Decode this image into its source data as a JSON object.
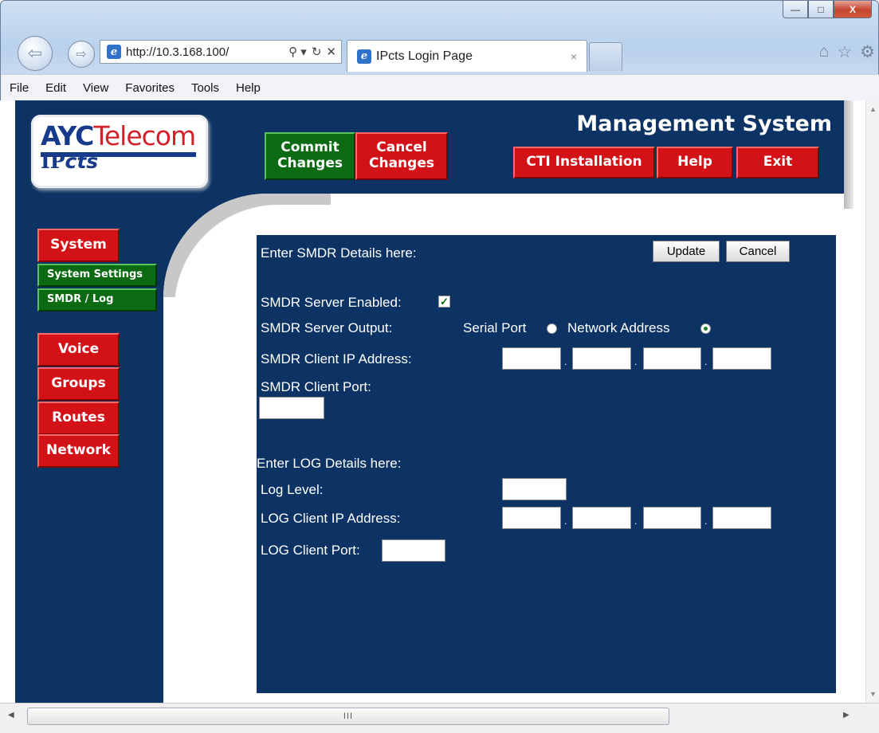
{
  "browser": {
    "window_controls": {
      "minimize": "—",
      "maximize": "□",
      "close": "X"
    },
    "address": "http://10.3.168.100/",
    "address_tools": [
      "⚲ ▾",
      "↻",
      "✕"
    ],
    "tab_title": "IPcts Login Page",
    "tab_close": "×",
    "toolbar_icons": [
      "⌂",
      "☆",
      "⚙"
    ],
    "menu": [
      "File",
      "Edit",
      "View",
      "Favorites",
      "Tools",
      "Help"
    ],
    "hscroll_grip": "III"
  },
  "header": {
    "logo_part1": "AYC",
    "logo_part2": "Telecom",
    "logo_sub1": "IP",
    "logo_sub2": "cts",
    "title": "Management System",
    "commit_line1": "Commit",
    "commit_line2": "Changes",
    "cancel_line1": "Cancel",
    "cancel_line2": "Changes",
    "cti": "CTI Installation",
    "help": "Help",
    "exit": "Exit"
  },
  "sidebar": {
    "system": "System",
    "system_settings": "System Settings",
    "smdr_log": "SMDR / Log",
    "voice": "Voice",
    "groups": "Groups",
    "routes": "Routes",
    "network": "Network"
  },
  "form": {
    "smdr_heading": "Enter SMDR Details here:",
    "update": "Update",
    "cancel": "Cancel",
    "smdr_enabled_label": "SMDR Server Enabled:",
    "smdr_enabled_checked": true,
    "smdr_output_label": "SMDR Server Output:",
    "output_option_serial": "Serial Port",
    "output_option_network": "Network Address",
    "output_selected": "Network Address",
    "smdr_client_ip_label": "SMDR Client IP Address:",
    "smdr_client_port_label": "SMDR Client Port:",
    "log_heading": "Enter LOG Details here:",
    "log_level_label": "Log Level:",
    "log_client_ip_label": "LOG Client IP Address:",
    "log_client_port_label": "LOG Client Port:",
    "ip_separator": "."
  },
  "colors": {
    "navy": "#0c3363",
    "red_button": "#d31218",
    "green_button": "#0b6a12"
  }
}
